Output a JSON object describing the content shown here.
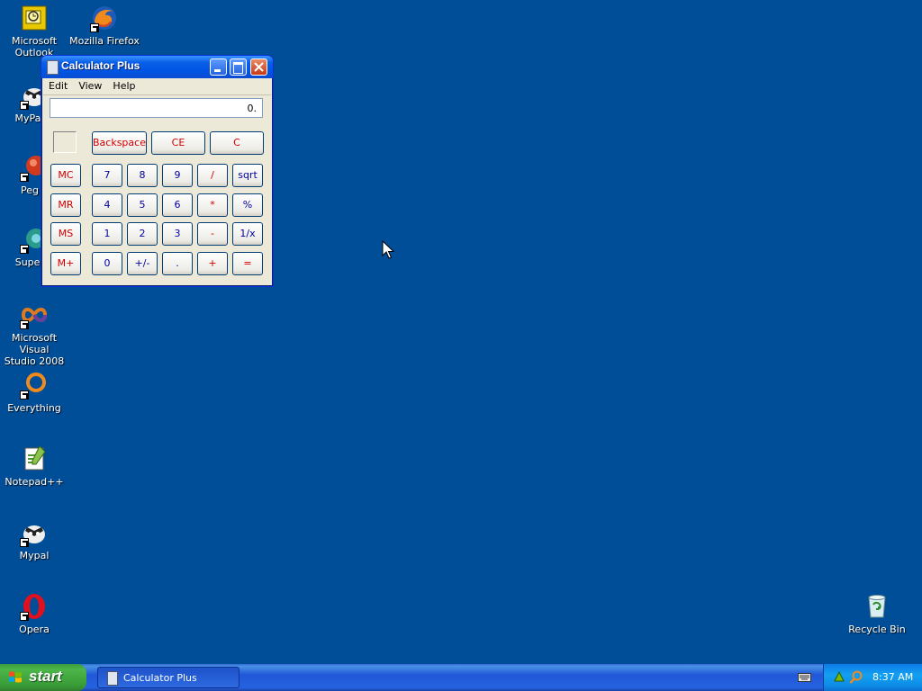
{
  "desktop": {
    "icons": [
      {
        "label": "Microsoft Outlook",
        "icon": "outlook-icon"
      },
      {
        "label": "Mozilla Firefox",
        "icon": "firefox-icon"
      },
      {
        "label": "MyPal",
        "icon": "mypal-icon"
      },
      {
        "label": "Pegasus",
        "icon": "pegasus-icon"
      },
      {
        "label": "Supermium",
        "icon": "supermium-icon"
      },
      {
        "label": "Microsoft Visual Studio 2008",
        "icon": "visual-studio-icon"
      },
      {
        "label": "Everything",
        "icon": "everything-icon"
      },
      {
        "label": "Notepad++",
        "icon": "notepadpp-icon"
      },
      {
        "label": "Mypal",
        "icon": "mypal-icon"
      },
      {
        "label": "Opera",
        "icon": "opera-icon"
      },
      {
        "label": "Recycle Bin",
        "icon": "recycle-bin-icon"
      }
    ],
    "visible_labels": {
      "outlook_l1": "Microsoft",
      "outlook_l2": "Outlook",
      "firefox": "Mozilla Firefox",
      "mypal_cut": "MyPa",
      "pegasus_cut": "Peg",
      "supermium_cut": "Superr",
      "vs_l1": "Microsoft Visual",
      "vs_l2": "Studio 2008",
      "everything": "Everything",
      "notepadpp": "Notepad++",
      "mypal": "Mypal",
      "opera": "Opera",
      "recycle": "Recycle Bin"
    }
  },
  "window": {
    "title": "Calculator Plus",
    "menu": [
      "Edit",
      "View",
      "Help"
    ],
    "display_value": "0.",
    "top_buttons": [
      "Backspace",
      "CE",
      "C"
    ],
    "memory_buttons": [
      "MC",
      "MR",
      "MS",
      "M+"
    ],
    "keypad": [
      [
        "7",
        "8",
        "9",
        "/",
        "sqrt"
      ],
      [
        "4",
        "5",
        "6",
        "*",
        "%"
      ],
      [
        "1",
        "2",
        "3",
        "-",
        "1/x"
      ],
      [
        "0",
        "+/-",
        ".",
        "+",
        "="
      ]
    ]
  },
  "taskbar": {
    "start_label": "start",
    "task_items": [
      "Calculator Plus"
    ],
    "clock": "8:37 AM"
  },
  "colors": {
    "desktop_bg": "#004E98",
    "title_blue": "#0054E3",
    "start_green": "#3C9A3C",
    "button_text_blue": "#0000A0",
    "button_text_red": "#D00000"
  }
}
